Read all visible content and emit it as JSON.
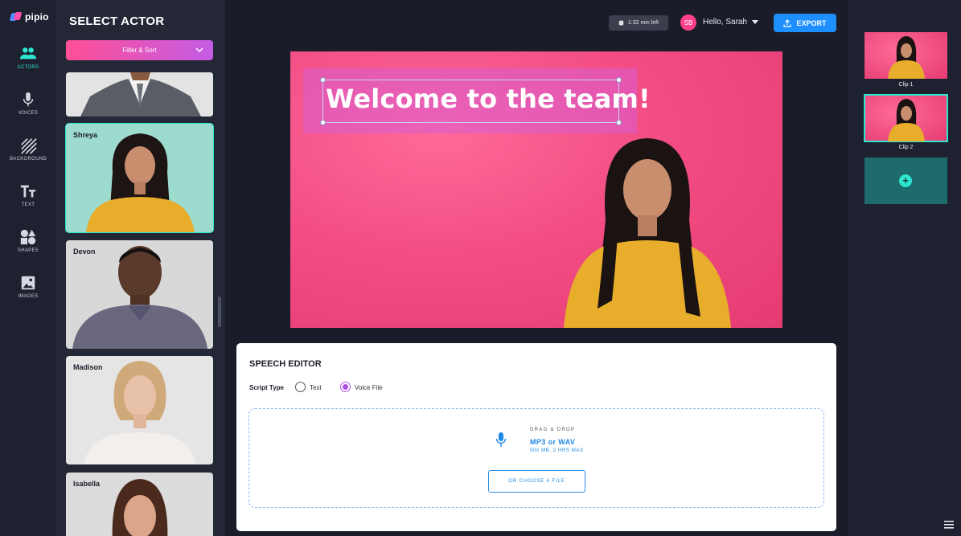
{
  "app": {
    "name": "pipio"
  },
  "rail": {
    "items": [
      {
        "label": "ACTORS",
        "icon": "people-icon",
        "active": true
      },
      {
        "label": "VOICES",
        "icon": "microphone-icon"
      },
      {
        "label": "BACKGROUND",
        "icon": "stripes-icon"
      },
      {
        "label": "TEXT",
        "icon": "text-icon"
      },
      {
        "label": "SHAPES",
        "icon": "shapes-icon"
      },
      {
        "label": "IMAGES",
        "icon": "image-icon"
      }
    ]
  },
  "panel": {
    "title": "SELECT ACTOR",
    "filter_label": "Filter & Sort",
    "actors": [
      {
        "name": ""
      },
      {
        "name": "Shreya",
        "selected": true
      },
      {
        "name": "Devon"
      },
      {
        "name": "Madison"
      },
      {
        "name": "Isabella"
      }
    ]
  },
  "topbar": {
    "time_left": "1:32 min left",
    "avatar_initials": "SB",
    "greeting": "Hello, Sarah",
    "export_label": "EXPORT"
  },
  "preview": {
    "title_text": "Welcome to the team!"
  },
  "speech": {
    "title": "SPEECH EDITOR",
    "script_type_label": "Script Type",
    "options": [
      {
        "label": "Text",
        "selected": false
      },
      {
        "label": "Voice File",
        "selected": true
      }
    ],
    "drop": {
      "hint": "DRAG & DROP",
      "formats": "MP3 or WAV",
      "limit": "500 MB, 2 HRS MAX",
      "button": "OR CHOOSE A FILE"
    }
  },
  "clips": {
    "items": [
      {
        "label": "Clip 1"
      },
      {
        "label": "Clip 2",
        "selected": true
      }
    ]
  },
  "colors": {
    "accent": "#2ee6d0",
    "brand_pink": "#ff4f96",
    "export_blue": "#1e8fff",
    "background": "#1a1d29"
  }
}
